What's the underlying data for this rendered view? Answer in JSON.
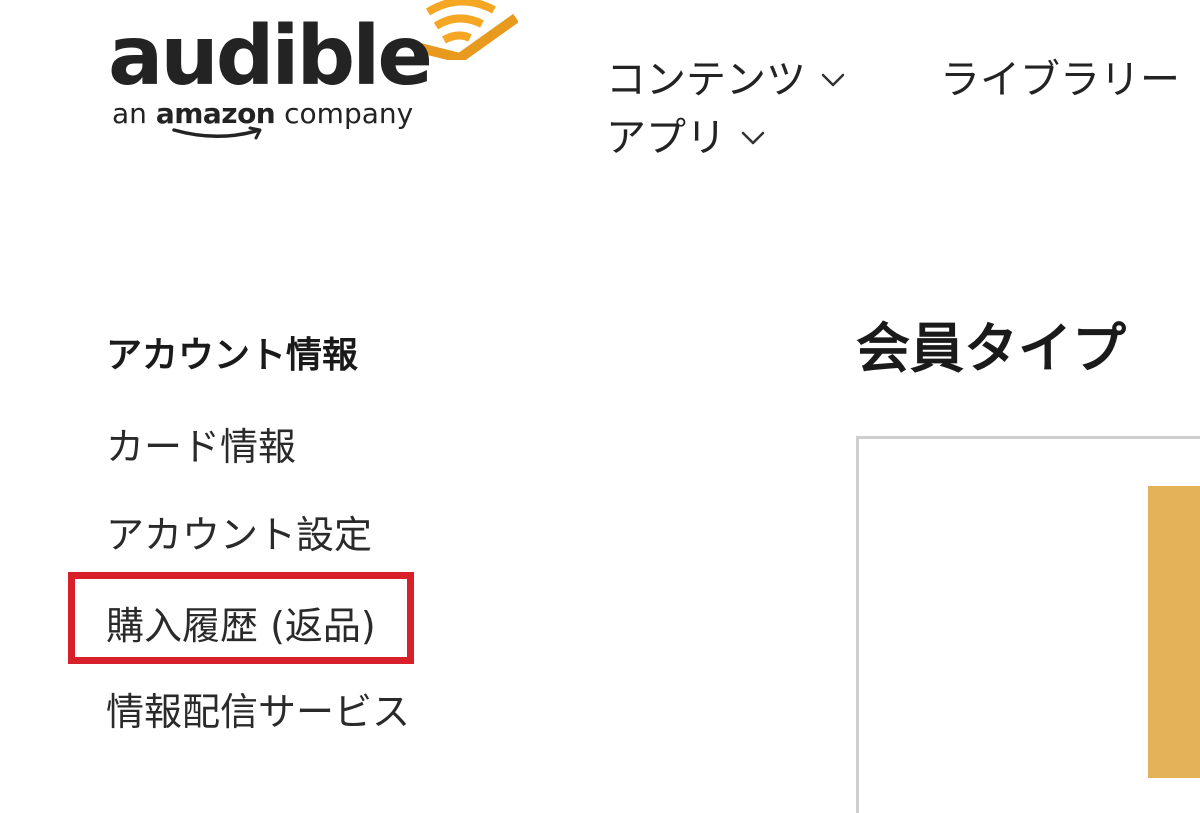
{
  "logo": {
    "wordmark": "audible",
    "tagline_prefix": "an ",
    "tagline_brand": "amazon",
    "tagline_suffix": " company",
    "signal_color": "#f5a623",
    "signal_icon": "audible-signal-icon"
  },
  "nav": {
    "contents_label": "コンテンツ",
    "library_label": "ライブラリー",
    "apps_label": "アプリ",
    "chevron_icon": "chevron-down-icon"
  },
  "sidebar": {
    "heading": "アカウント情報",
    "items": [
      {
        "label": "カード情報"
      },
      {
        "label": "アカウント設定"
      },
      {
        "label": "購入履歴 (返品)"
      },
      {
        "label": "情報配信サービス"
      }
    ],
    "highlight_color": "#d8202b"
  },
  "main": {
    "title": "会員タイプ",
    "banner_color": "#e3b35a"
  }
}
